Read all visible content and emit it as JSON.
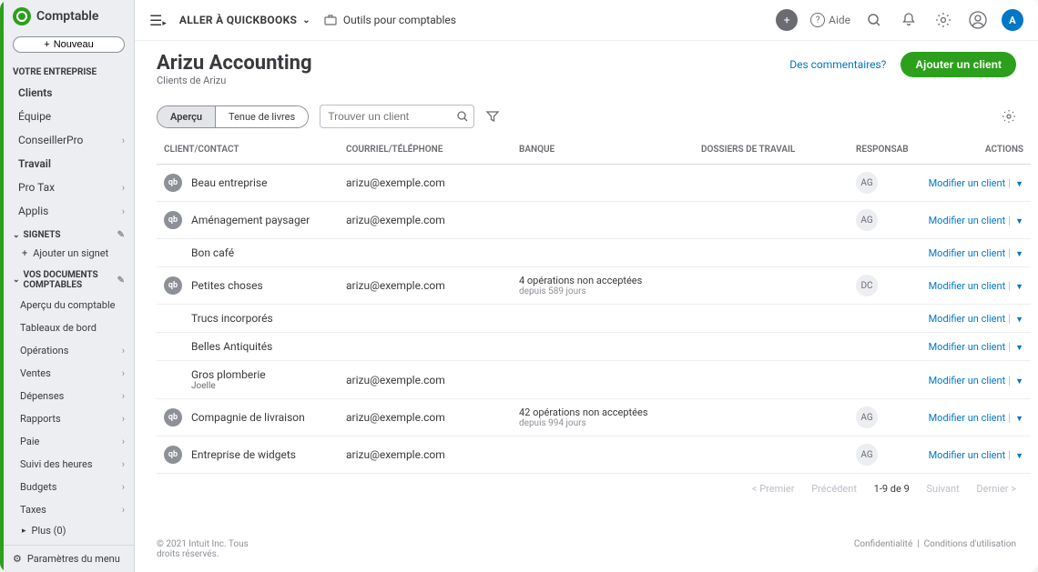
{
  "brand": "Comptable",
  "nouveau_btn": "Nouveau",
  "sidebar": {
    "section1": "VOTRE ENTREPRISE",
    "items1": [
      {
        "label": "Clients",
        "bold": true
      },
      {
        "label": "Équipe"
      },
      {
        "label": "ConseillerPro",
        "chev": true
      },
      {
        "label": "Travail",
        "bold": true
      },
      {
        "label": "Pro Tax",
        "chev": true
      },
      {
        "label": "Applis",
        "chev": true
      }
    ],
    "section2": "SIGNETS",
    "add_bookmark": "Ajouter un signet",
    "section3": "VOS DOCUMENTS COMPTABLES",
    "items3": [
      {
        "label": "Aperçu du comptable"
      },
      {
        "label": "Tableaux de bord"
      },
      {
        "label": "Opérations",
        "chev": true
      },
      {
        "label": "Ventes",
        "chev": true
      },
      {
        "label": "Dépenses",
        "chev": true
      },
      {
        "label": "Rapports",
        "chev": true
      },
      {
        "label": "Paie",
        "chev": true
      },
      {
        "label": "Suivi des heures",
        "chev": true
      },
      {
        "label": "Budgets",
        "chev": true
      },
      {
        "label": "Taxes",
        "chev": true
      }
    ],
    "plus": "Plus (0)",
    "menu_params": "Paramètres du menu"
  },
  "topbar": {
    "go_qb": "ALLER À QUICKBOOKS",
    "tools": "Outils pour comptables",
    "aide": "Aide"
  },
  "header": {
    "title": "Arizu Accounting",
    "subtitle": "Clients de Arizu",
    "feedback": "Des commentaires?",
    "add_client": "Ajouter un client"
  },
  "tabs": {
    "t1": "Aperçu",
    "t2": "Tenue de livres"
  },
  "search_placeholder": "Trouver un client",
  "columns": {
    "client": "CLIENT/CONTACT",
    "email": "COURRIEL/TÉLÉPHONE",
    "bank": "BANQUE",
    "dossiers": "DOSSIERS DE TRAVAIL",
    "resp": "RESPONSAB",
    "actions": "ACTIONS"
  },
  "action_label": "Modifier un client",
  "rows": [
    {
      "qb": true,
      "name": "Beau entreprise",
      "email": "arizu@exemple.com",
      "bank": "",
      "bank_sub": "",
      "resp": "AG"
    },
    {
      "qb": true,
      "name": "Aménagement paysager",
      "email": "arizu@exemple.com",
      "bank": "",
      "bank_sub": "",
      "resp": "AG"
    },
    {
      "qb": false,
      "name": "Bon café",
      "email": "",
      "bank": "",
      "bank_sub": "",
      "resp": ""
    },
    {
      "qb": true,
      "name": "Petites choses",
      "email": "arizu@exemple.com",
      "bank": "4 opérations non acceptées",
      "bank_sub": "depuis 589 jours",
      "resp": "DC"
    },
    {
      "qb": false,
      "name": "Trucs incorporés",
      "email": "",
      "bank": "",
      "bank_sub": "",
      "resp": ""
    },
    {
      "qb": false,
      "name": "Belles Antiquités",
      "email": "",
      "bank": "",
      "bank_sub": "",
      "resp": ""
    },
    {
      "qb": false,
      "name": "Gros plomberie",
      "sub": "Joelle",
      "email": "arizu@exemple.com",
      "bank": "",
      "bank_sub": "",
      "resp": ""
    },
    {
      "qb": true,
      "name": "Compagnie de livraison",
      "email": "arizu@exemple.com",
      "bank": "42 opérations non acceptées",
      "bank_sub": "depuis 994 jours",
      "resp": "AG"
    },
    {
      "qb": true,
      "name": "Entreprise de widgets",
      "email": "arizu@exemple.com",
      "bank": "",
      "bank_sub": "",
      "resp": "AG"
    }
  ],
  "pager": {
    "first": "< Premier",
    "prev": "Précédent",
    "range": "1-9 de 9",
    "next": "Suivant",
    "last": "Dernier >"
  },
  "footer": {
    "copy": "© 2021 Intuit Inc. Tous droits réservés.",
    "privacy": "Confidentialité",
    "terms": "Conditions d'utilisation"
  }
}
